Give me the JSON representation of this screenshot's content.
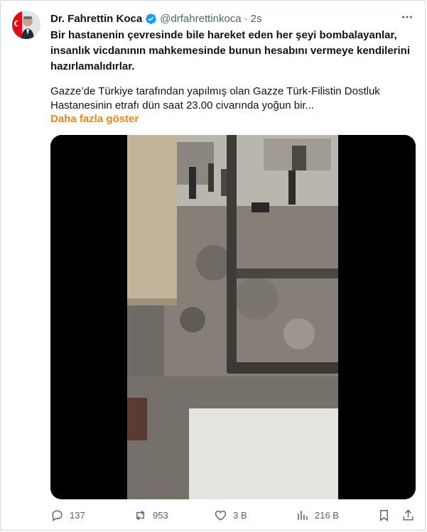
{
  "author": {
    "name": "Dr. Fahrettin Koca",
    "handle": "@drfahrettinkoca",
    "separator": "·",
    "time": "2s",
    "verified_color": "#1d9bf0"
  },
  "tweet": {
    "bold_lines": [
      "Bir hastanenin çevresinde bile hareket eden her şeyi bombalayanlar,",
      "insanlık vicdanının mahkemesinde bunun hesabını vermeye kendilerini",
      "hazırlamalıdırlar."
    ],
    "body_lines": [
      "Gazze’de Türkiye tarafından yapılmış olan Gazze Türk-Filistin Dostluk",
      "Hastanesinin etrafı dün saat 23.00 civarında yoğun bir..."
    ],
    "show_more": "Daha fazla göster",
    "show_more_color": "#f0880c"
  },
  "actions": {
    "replies": "137",
    "retweets": "953",
    "likes": "3 B",
    "views": "216 B"
  },
  "icons": {
    "more": "more-dots-icon",
    "verified": "verified-badge-icon",
    "reply": "reply-icon",
    "retweet": "retweet-icon",
    "like": "heart-icon",
    "views": "views-chart-icon",
    "bookmark": "bookmark-icon",
    "share": "share-icon"
  }
}
